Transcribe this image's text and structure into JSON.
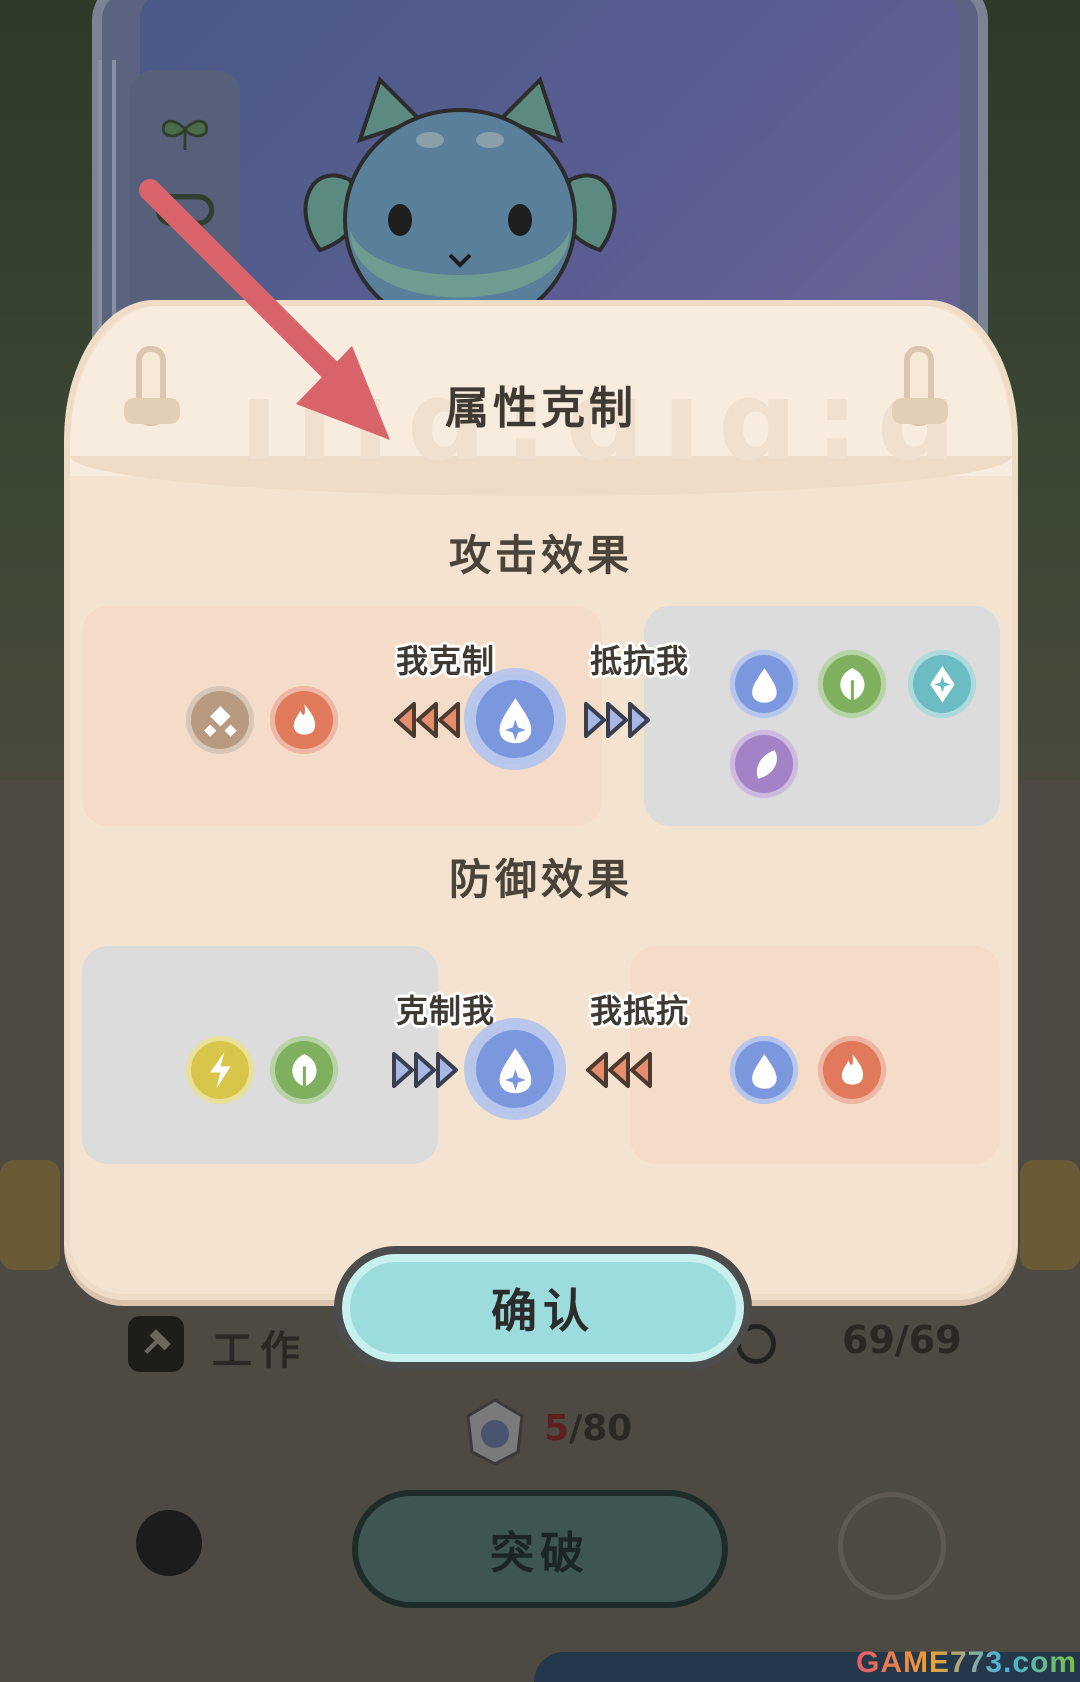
{
  "dialog": {
    "title": "属性克制",
    "header_letters": "ıııɑ:ɑıɑ:ɑ",
    "attack_section": {
      "title": "攻击效果",
      "strong_against_label": "我克制",
      "resisted_by_label": "抵抗我",
      "weak_targets": [
        "earth-icon",
        "fire-icon"
      ],
      "resisting_targets": [
        "water-icon",
        "grass-icon",
        "ice-icon",
        "fairy-icon"
      ]
    },
    "defense_section": {
      "title": "防御效果",
      "countered_by_label": "克制我",
      "i_resist_label": "我抵抗",
      "countered_by_types": [
        "electric-icon",
        "grass-icon"
      ],
      "i_resist_types": [
        "water-icon",
        "fire-icon"
      ]
    },
    "center_type": "water-icon",
    "confirm_label": "确认"
  },
  "background": {
    "work_label": "工作",
    "hp": "69/69",
    "level_current": "5",
    "level_max": "/80",
    "breakthrough_label": "突破"
  },
  "watermark": "GAME773.com",
  "colors": {
    "water": "#7b98de",
    "fire": "#e07a5a",
    "earth": "#b89a80",
    "grass": "#7fb05e",
    "ice": "#6cbcc4",
    "fairy": "#a382c8",
    "electric": "#d8c64a",
    "confirm": "#9ddcdc",
    "arrow": "#d9636a"
  }
}
